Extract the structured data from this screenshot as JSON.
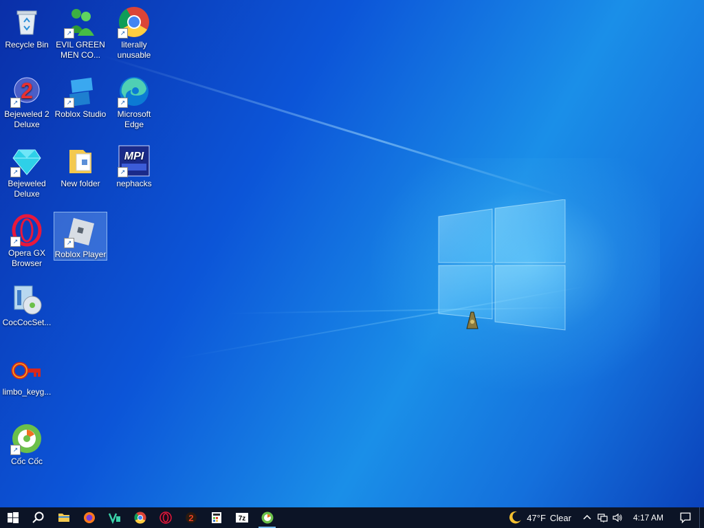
{
  "desktop": {
    "icons": [
      {
        "label": "Recycle Bin"
      },
      {
        "label": "EVIL GREEN MEN CO..."
      },
      {
        "label": "literally unusable"
      },
      {
        "label": "Bejeweled 2 Deluxe"
      },
      {
        "label": "Roblox Studio"
      },
      {
        "label": "Microsoft Edge"
      },
      {
        "label": "Bejeweled Deluxe"
      },
      {
        "label": "New folder"
      },
      {
        "label": "nephacks"
      },
      {
        "label": "Opera GX Browser"
      },
      {
        "label": "Roblox Player"
      },
      {
        "label": "CocCocSet..."
      },
      {
        "label": "limbo_keyg..."
      },
      {
        "label": "Cốc Cốc"
      }
    ],
    "icon_names": [
      "recycle-bin-icon",
      "green-men-icon",
      "chrome-icon",
      "bejeweled2-icon",
      "roblox-studio-icon",
      "edge-icon",
      "gem-icon",
      "folder-icon",
      "mpi-icon",
      "opera-gx-icon",
      "roblox-icon",
      "installer-icon",
      "key-icon",
      "coccoc-icon"
    ]
  },
  "taskbar": {
    "buttons": [
      "start-icon",
      "search-icon",
      "file-explorer-icon",
      "firefox-icon",
      "vegas-icon",
      "chrome-icon",
      "opera-gx-icon",
      "bejeweled-icon",
      "calculator-icon",
      "7zip-icon",
      "coccoc-icon"
    ],
    "zip_label": "7z",
    "weather": {
      "temp": "47°F",
      "condition": "Clear"
    },
    "time": "4:17 AM"
  },
  "colors": {
    "taskbar": "#0c1426",
    "wallpaper_accent": "#1a8fe8",
    "selection": "#aad2ff"
  }
}
